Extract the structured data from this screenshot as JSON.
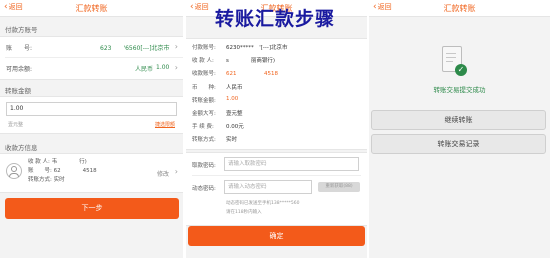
{
  "overlay_title": "转账汇款步骤",
  "screen1": {
    "header": {
      "back": "返回",
      "title": "汇款转账"
    },
    "payer_section": "付款方账号",
    "account_label": "账　　号:",
    "account_value": "623　　'6560[---]北京市",
    "balance_label": "可用余额:",
    "balance_currency": "人民币",
    "balance_value": "1.00",
    "amount_section": "转账金额",
    "amount_value": "1.00",
    "amount_words": "壹元整",
    "amount_link": "捷选限额",
    "payee_section": "收款方信息",
    "payee_name_label": "收 款 人:",
    "payee_name_value": "韦　　　　行)",
    "payee_account_label": "账　　号:",
    "payee_account_value": "62　　　　4518",
    "payee_mode_label": "转账方式:",
    "payee_mode_value": "实时",
    "payee_edit": "修改",
    "next_button": "下一步"
  },
  "screen2": {
    "header": {
      "back": "返回",
      "title": "汇款转账"
    },
    "rows": [
      {
        "label": "付款账号:",
        "value": "6230*****　'[---]北京市",
        "color": "#333333"
      },
      {
        "label": "收 款 人:",
        "value": "s　　　　丽商银行)",
        "color": "#333333"
      },
      {
        "label": "收款账号:",
        "value": "621　　　　　4518",
        "color": "#f0641e"
      },
      {
        "label": "币　　种:",
        "value": "人民币",
        "color": "#333333"
      },
      {
        "label": "转账金额:",
        "value": "1.00",
        "color": "#f0641e"
      },
      {
        "label": "金额大写:",
        "value": "壹元整",
        "color": "#333333"
      },
      {
        "label": "手 续 费:",
        "value": "0.00元",
        "color": "#333333"
      },
      {
        "label": "转账方式:",
        "value": "实时",
        "color": "#333333"
      }
    ],
    "pwd_label": "取款密码:",
    "pwd_placeholder": "请输入取款密码",
    "code_label": "动态密码:",
    "code_placeholder": "请输入动态密码",
    "resend": "重新获取(88)",
    "hint1": "动态密码已发送至手机138*****560",
    "hint2": "请在118秒内输入",
    "confirm_button": "确定"
  },
  "screen3": {
    "header": {
      "back": "返回",
      "title": "汇款转账"
    },
    "success_text": "转账交易提交成功",
    "continue_button": "继续转账",
    "records_button": "转账交易记录"
  },
  "colors": {
    "accent": "#f0641e",
    "success": "#2d8a4a",
    "overlay": "#1a1aa0"
  }
}
